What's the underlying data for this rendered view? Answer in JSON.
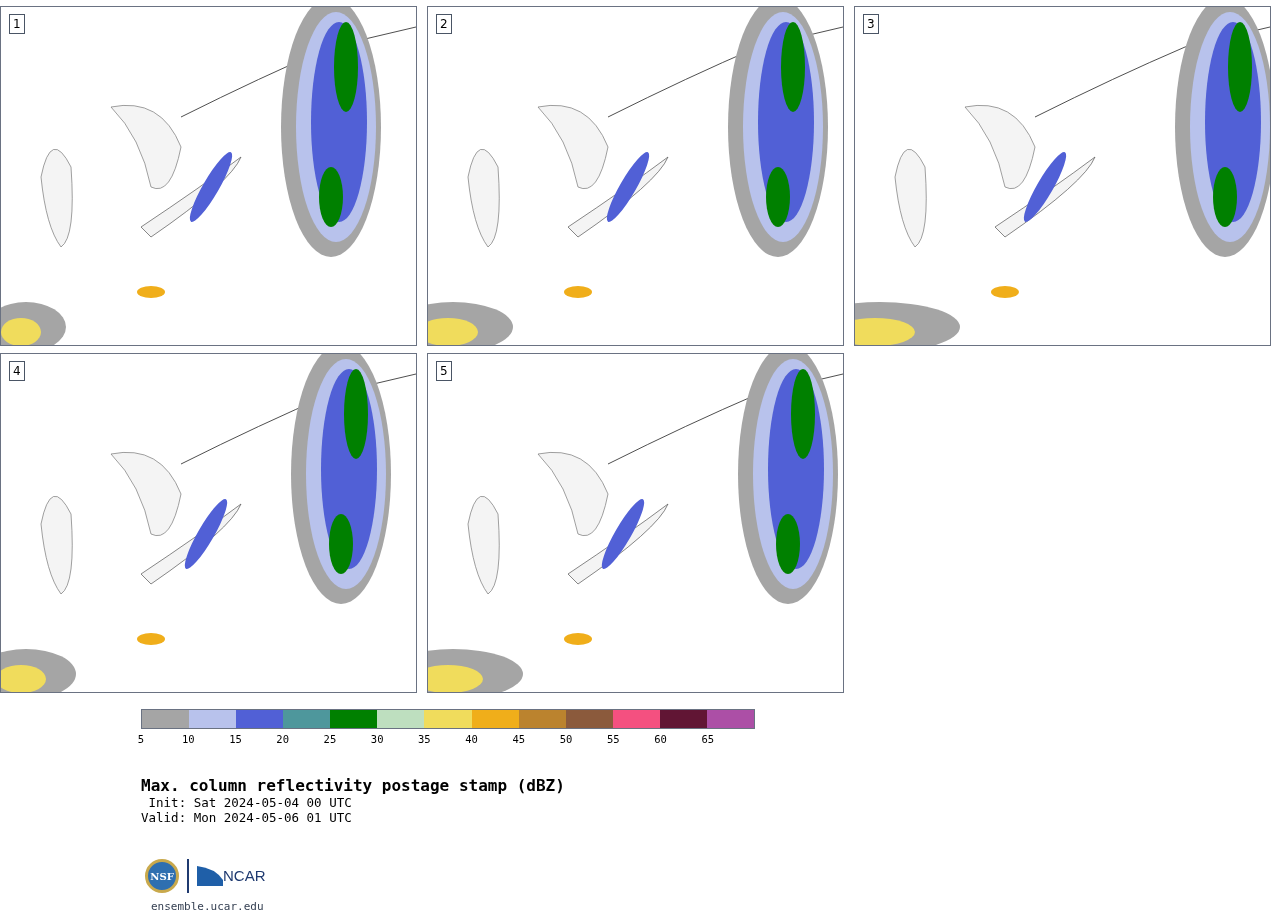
{
  "panels": [
    {
      "label": "1"
    },
    {
      "label": "2"
    },
    {
      "label": "3"
    },
    {
      "label": "4"
    },
    {
      "label": "5"
    }
  ],
  "colorbar": {
    "bins": [
      {
        "color": "#a5a5a5"
      },
      {
        "color": "#b8c2ec"
      },
      {
        "color": "#5160d6"
      },
      {
        "color": "#4e979c"
      },
      {
        "color": "#008000"
      },
      {
        "color": "#bedfbf"
      },
      {
        "color": "#f0dc5c"
      },
      {
        "color": "#f0ae1a"
      },
      {
        "color": "#bb832e"
      },
      {
        "color": "#8b5a3c"
      },
      {
        "color": "#f45080"
      },
      {
        "color": "#611534"
      },
      {
        "color": "#ac4fa6"
      }
    ],
    "ticks": [
      "5",
      "10",
      "15",
      "20",
      "25",
      "30",
      "35",
      "40",
      "45",
      "50",
      "55",
      "60",
      "65"
    ]
  },
  "title": "Max. column reflectivity postage stamp (dBZ)",
  "init": " Init: Sat 2024-05-04 00 UTC",
  "valid": "Valid: Mon 2024-05-06 01 UTC",
  "logos": {
    "nsf": "NSF",
    "ncar": "NCAR"
  },
  "footer": "ensemble.ucar.edu"
}
